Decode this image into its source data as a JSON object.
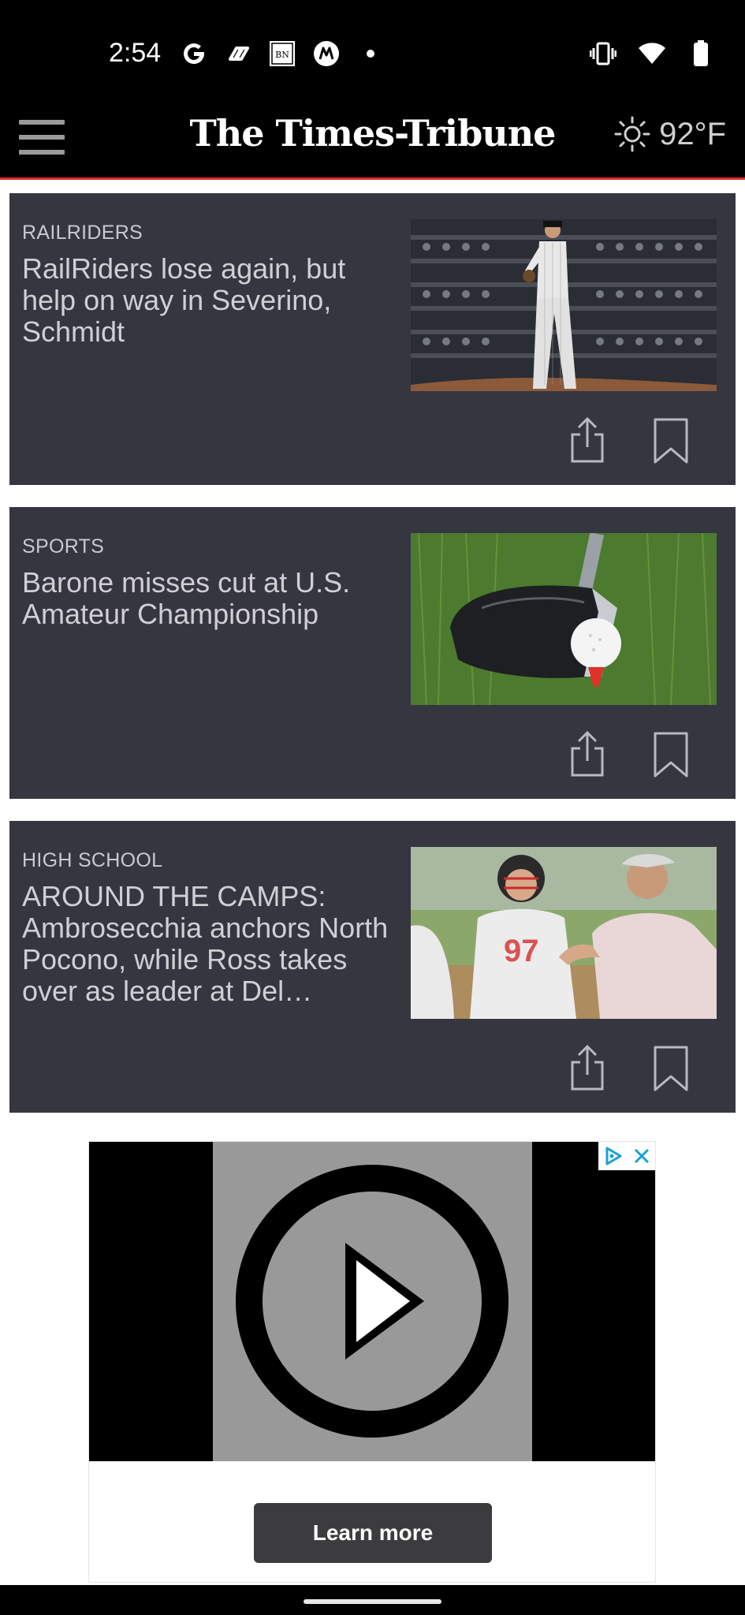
{
  "status_bar": {
    "time": "2:54",
    "left_icons": [
      "google-icon",
      "link-app-icon",
      "bn-app-icon",
      "m-app-icon",
      "dot-icon"
    ],
    "right_icons": [
      "vibrate-icon",
      "wifi-icon",
      "battery-icon"
    ]
  },
  "header": {
    "brand": "The Times-Tribune",
    "weather_temp": "92°F",
    "weather_icon": "sun-icon",
    "accent_color": "#e0262f"
  },
  "articles": [
    {
      "category": "RAILRIDERS",
      "title": "RailRiders lose again, but help on way in Severino, Schmidt",
      "image": "baseball-pitcher-photo"
    },
    {
      "category": "SPORTS",
      "title": "Barone misses cut at U.S. Amateur Championship",
      "image": "golf-driver-ball-photo"
    },
    {
      "category": "HIGH SCHOOL",
      "title": "AROUND THE CAMPS: Ambrosecchia anchors North Pocono, while Ross takes over as leader at Del…",
      "image": "football-player-coach-photo"
    }
  ],
  "ad": {
    "cta_label": "Learn more",
    "icons": [
      "play-icon",
      "adchoices-icon",
      "close-icon"
    ]
  }
}
